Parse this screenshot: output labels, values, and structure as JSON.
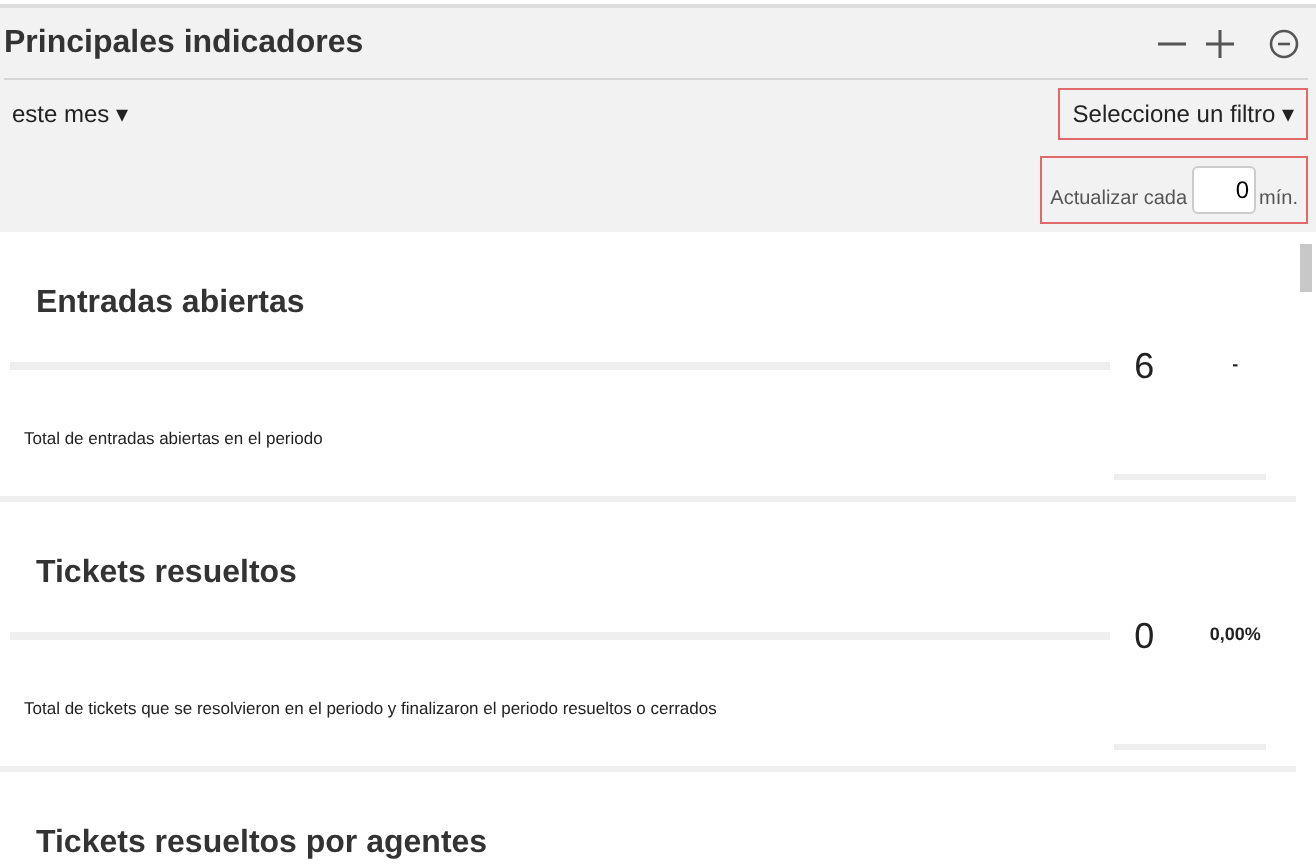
{
  "panel": {
    "title": "Principales indicadores"
  },
  "period": {
    "label": "este mes",
    "caret": "▾"
  },
  "filter": {
    "label": "Seleccione un filtro",
    "caret": "▾"
  },
  "refresh": {
    "label": "Actualizar cada",
    "value": "0",
    "unit": "mín."
  },
  "indicators": [
    {
      "title": "Entradas abiertas",
      "value": "6",
      "change": "-",
      "description": "Total de entradas abiertas en el periodo"
    },
    {
      "title": "Tickets resueltos",
      "value": "0",
      "change": "0,00%",
      "description": "Total de tickets que se resolvieron en el periodo y finalizaron el periodo resueltos o cerrados"
    },
    {
      "title": "Tickets resueltos por agentes"
    }
  ]
}
